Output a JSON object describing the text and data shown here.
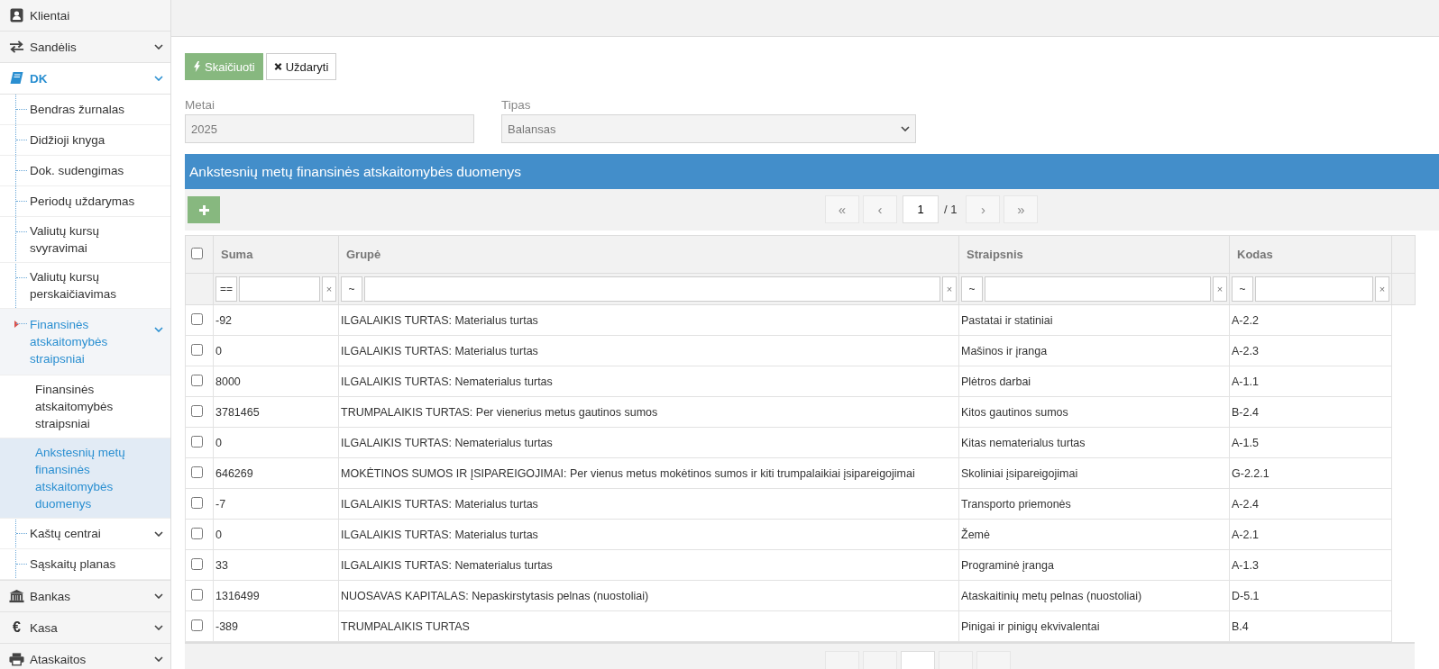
{
  "sidebar": {
    "items": [
      {
        "label": "Klientai",
        "expandable": false,
        "expanded": false,
        "selected": false
      },
      {
        "label": "Sandėlis",
        "expandable": true,
        "expanded": false,
        "selected": false
      },
      {
        "label": "DK",
        "expandable": true,
        "expanded": true,
        "selected": false,
        "children": [
          {
            "label": "Bendras žurnalas",
            "expandable": false,
            "expanded": false,
            "selected": false
          },
          {
            "label": "Didžioji knyga",
            "expandable": false,
            "expanded": false,
            "selected": false
          },
          {
            "label": "Dok. sudengimas",
            "expandable": false,
            "expanded": false,
            "selected": false
          },
          {
            "label": "Periodų uždarymas",
            "expandable": false,
            "expanded": false,
            "selected": false
          },
          {
            "label": "Valiutų kursų svyravimai",
            "expandable": false,
            "expanded": false,
            "selected": false
          },
          {
            "label": "Valiutų kursų perskaičiavimas",
            "expandable": false,
            "expanded": false,
            "selected": false
          },
          {
            "label": "Finansinės atskaitomybės straipsniai",
            "expandable": true,
            "expanded": true,
            "selected": false,
            "children": [
              {
                "label": "Finansinės atskaitomybės straipsniai",
                "expandable": false,
                "expanded": false,
                "selected": false
              },
              {
                "label": "Ankstesnių metų finansinės atskaitomybės duomenys",
                "expandable": false,
                "expanded": false,
                "selected": true
              }
            ]
          },
          {
            "label": "Kaštų centrai",
            "expandable": true,
            "expanded": false,
            "selected": false
          },
          {
            "label": "Sąskaitų planas",
            "expandable": false,
            "expanded": false,
            "selected": false
          }
        ]
      },
      {
        "label": "Bankas",
        "expandable": true,
        "expanded": false,
        "selected": false
      },
      {
        "label": "Kasa",
        "glyph": "€",
        "expandable": true,
        "expanded": false,
        "selected": false
      },
      {
        "label": "Ataskaitos",
        "expandable": true,
        "expanded": false,
        "selected": false
      }
    ]
  },
  "toolbar": {
    "buttons": [
      {
        "kind": "primary",
        "label": "Skaičiuoti"
      },
      {
        "kind": "default",
        "label": "Uždaryti"
      }
    ]
  },
  "form": {
    "fields": [
      {
        "kind": "input",
        "label": "Metai",
        "value": "2025"
      },
      {
        "kind": "select",
        "label": "Tipas",
        "value": "Balansas"
      }
    ]
  },
  "panel": {
    "title": "Ankstesnių metų finansinės atskaitomybės duomenys",
    "pager": {
      "first": "«",
      "prev": "‹",
      "page": "1",
      "total": "/ 1",
      "next": "›",
      "last": "»",
      "disabled": true
    },
    "table": {
      "select_all_checked": false,
      "columns": [
        {
          "label": "Suma",
          "operator": "==",
          "clear": "×"
        },
        {
          "label": "Grupė",
          "operator": "~",
          "clear": "×"
        },
        {
          "label": "Straipsnis",
          "operator": "~",
          "clear": "×"
        },
        {
          "label": "Kodas",
          "operator": "~",
          "clear": "×"
        }
      ],
      "rows": [
        {
          "checked": false,
          "cells": [
            "-92",
            "ILGALAIKIS TURTAS: Materialus turtas",
            "Pastatai ir statiniai",
            "A-2.2"
          ]
        },
        {
          "checked": false,
          "cells": [
            "0",
            "ILGALAIKIS TURTAS: Materialus turtas",
            "Mašinos ir įranga",
            "A-2.3"
          ]
        },
        {
          "checked": false,
          "cells": [
            "8000",
            "ILGALAIKIS TURTAS: Nematerialus turtas",
            "Plėtros darbai",
            "A-1.1"
          ]
        },
        {
          "checked": false,
          "cells": [
            "3781465",
            "TRUMPALAIKIS TURTAS: Per vienerius metus gautinos sumos",
            "Kitos gautinos sumos",
            "B-2.4"
          ]
        },
        {
          "checked": false,
          "cells": [
            "0",
            "ILGALAIKIS TURTAS: Nematerialus turtas",
            "Kitas nematerialus turtas",
            "A-1.5"
          ]
        },
        {
          "checked": false,
          "cells": [
            "646269",
            "MOKĖTINOS SUMOS IR ĮSIPAREIGOJIMAI: Per vienus metus mokėtinos sumos ir kiti trumpalaikiai įsipareigojimai",
            "Skoliniai įsipareigojimai",
            "G-2.2.1"
          ]
        },
        {
          "checked": false,
          "cells": [
            "-7",
            "ILGALAIKIS TURTAS: Materialus turtas",
            "Transporto priemonės",
            "A-2.4"
          ]
        },
        {
          "checked": false,
          "cells": [
            "0",
            "ILGALAIKIS TURTAS: Materialus turtas",
            "Žemė",
            "A-2.1"
          ]
        },
        {
          "checked": false,
          "cells": [
            "33",
            "ILGALAIKIS TURTAS: Nematerialus turtas",
            "Programinė įranga",
            "A-1.3"
          ]
        },
        {
          "checked": false,
          "cells": [
            "1316499",
            "NUOSAVAS KAPITALAS: Nepaskirstytasis pelnas (nuostoliai)",
            "Ataskaitinių metų pelnas (nuostoliai)",
            "D-5.1"
          ]
        },
        {
          "checked": false,
          "cells": [
            "-389",
            "TRUMPALAIKIS TURTAS",
            "Pinigai ir pinigų ekvivalentai",
            "B.4"
          ]
        }
      ]
    }
  }
}
